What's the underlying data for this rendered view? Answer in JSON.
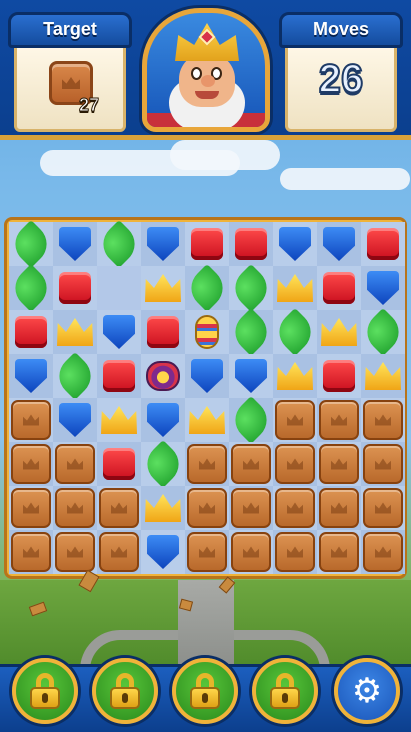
{
  "hud": {
    "target_label": "Target",
    "target_count": "27",
    "target_icon": "wooden-crown-box-icon",
    "moves_label": "Moves",
    "moves_value": "26",
    "portrait_icon": "king-portrait"
  },
  "board": {
    "rows": [
      [
        "green",
        "blue",
        "green",
        "blue",
        "red",
        "red",
        "blue",
        "blue",
        "red"
      ],
      [
        "green",
        "red",
        "empty",
        "yellow",
        "green",
        "green",
        "yellow",
        "red",
        "blue"
      ],
      [
        "red",
        "yellow",
        "blue",
        "red",
        "rocket",
        "green",
        "green",
        "yellow",
        "green"
      ],
      [
        "blue",
        "green",
        "red",
        "bomb",
        "blue",
        "blue",
        "yellow",
        "red",
        "yellow"
      ],
      [
        "box",
        "blue",
        "yellow",
        "blue",
        "yellow",
        "green",
        "box",
        "box",
        "box"
      ],
      [
        "box",
        "box",
        "red",
        "green",
        "box",
        "box",
        "box",
        "box",
        "box"
      ],
      [
        "box",
        "box",
        "box",
        "yellow",
        "box",
        "box",
        "box",
        "box",
        "box"
      ],
      [
        "box",
        "box",
        "box",
        "blue",
        "box",
        "box",
        "box",
        "box",
        "box"
      ]
    ]
  },
  "boosters": [
    {
      "icon": "lock-icon",
      "locked": true
    },
    {
      "icon": "lock-icon",
      "locked": true
    },
    {
      "icon": "lock-icon",
      "locked": true
    },
    {
      "icon": "lock-icon",
      "locked": true
    }
  ],
  "settings": {
    "icon": "gear-icon",
    "glyph": "⚙"
  },
  "colors": {
    "hud_blue": "#0f4aa3",
    "gold_border": "#f0b33a",
    "red_piece": "#e0202e",
    "blue_piece": "#1f62d6",
    "green_piece": "#2ab83a",
    "yellow_piece": "#f7c431",
    "box_piece": "#c87a3a"
  }
}
